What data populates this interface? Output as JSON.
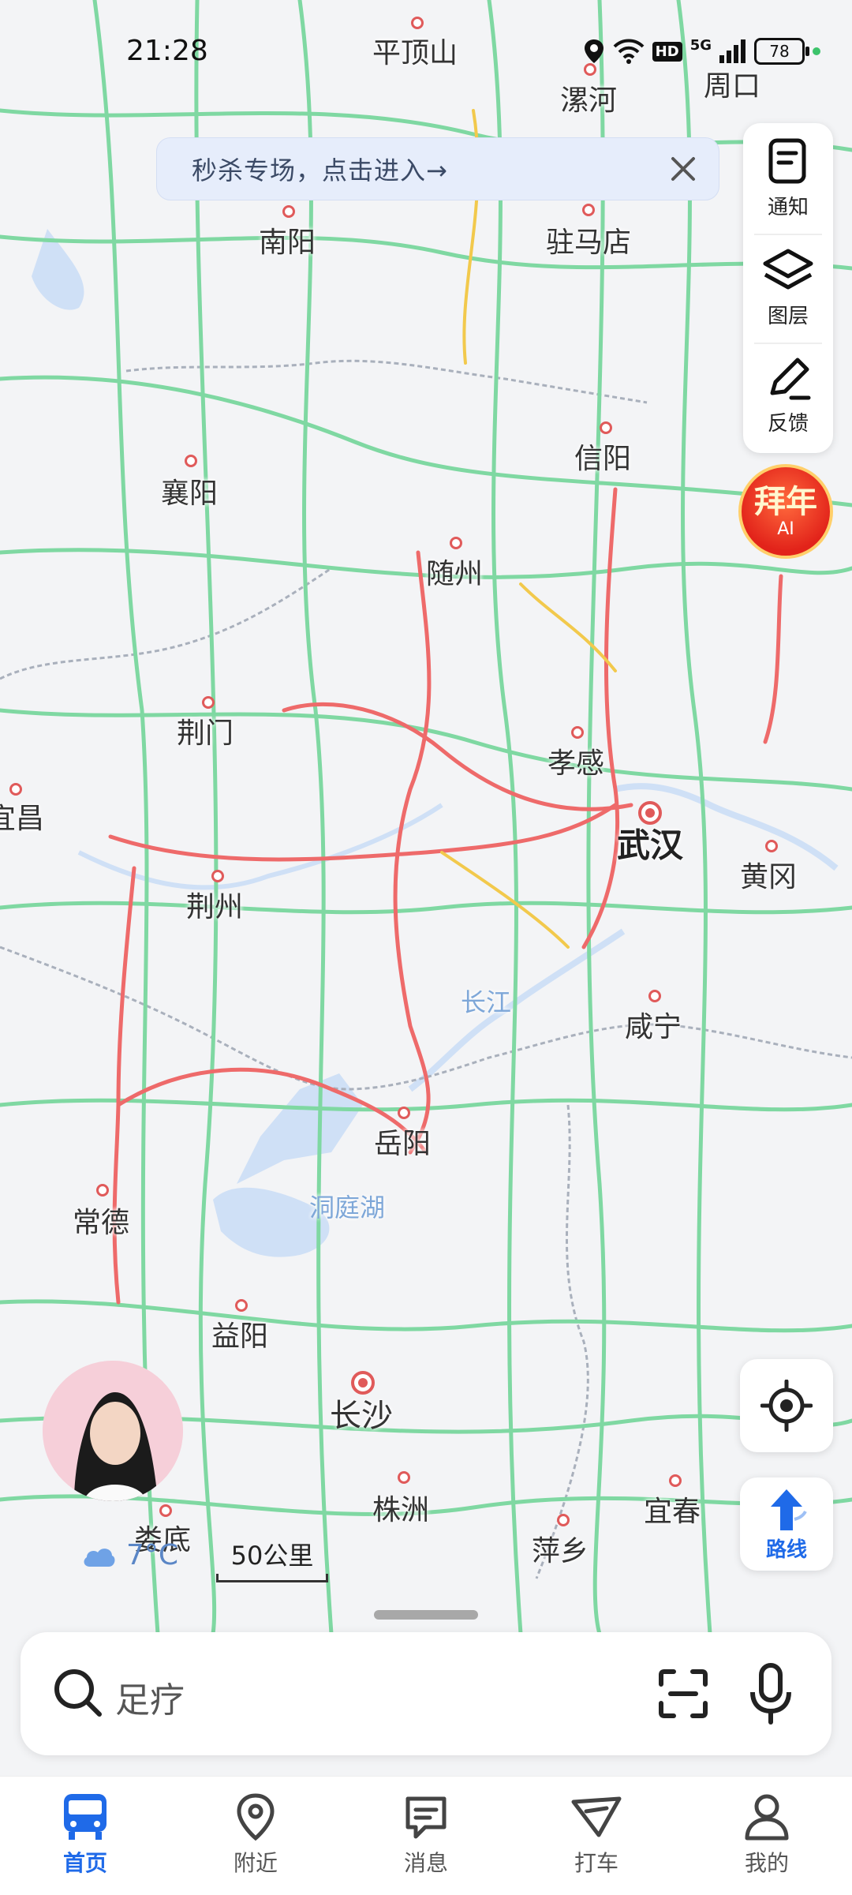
{
  "status_bar": {
    "time": "21:28",
    "network": "5G",
    "hd": "HD",
    "battery": "78"
  },
  "promo": {
    "text": "秒杀专场，点击进入→"
  },
  "tools": [
    {
      "label": "通知",
      "icon": "notification-icon"
    },
    {
      "label": "图层",
      "icon": "layers-icon"
    },
    {
      "label": "反馈",
      "icon": "feedback-icon"
    }
  ],
  "ai_badge": {
    "line1": "拜年",
    "line2": "AI"
  },
  "map": {
    "cities": [
      {
        "id": "pingdingshan",
        "name": "平顶山"
      },
      {
        "id": "luohe",
        "name": "漯河"
      },
      {
        "id": "zhoukou",
        "name": "周口"
      },
      {
        "id": "nanyang",
        "name": "南阳"
      },
      {
        "id": "zhumadian",
        "name": "驻马店"
      },
      {
        "id": "xinyang",
        "name": "信阳"
      },
      {
        "id": "xiangyang",
        "name": "襄阳"
      },
      {
        "id": "suizhou",
        "name": "随州"
      },
      {
        "id": "jingmen",
        "name": "荆门"
      },
      {
        "id": "xiaogan",
        "name": "孝感"
      },
      {
        "id": "yichang",
        "name": "宜昌"
      },
      {
        "id": "wuhan",
        "name": "武汉"
      },
      {
        "id": "huanggang",
        "name": "黄冈"
      },
      {
        "id": "jingzhou",
        "name": "荆州"
      },
      {
        "id": "changjiang",
        "name": "长江"
      },
      {
        "id": "xianning",
        "name": "咸宁"
      },
      {
        "id": "yueyang",
        "name": "岳阳"
      },
      {
        "id": "dongtinghu",
        "name": "洞庭湖"
      },
      {
        "id": "changde",
        "name": "常德"
      },
      {
        "id": "yiyang",
        "name": "益阳"
      },
      {
        "id": "changsha",
        "name": "长沙"
      },
      {
        "id": "zhuzhou",
        "name": "株洲"
      },
      {
        "id": "yichun",
        "name": "宜春"
      },
      {
        "id": "pingxiang",
        "name": "萍乡"
      },
      {
        "id": "loudi",
        "name": "娄底"
      }
    ]
  },
  "weather": {
    "temperature": "7°C",
    "icon": "cloud-icon"
  },
  "scale": {
    "label": "50公里"
  },
  "controls": {
    "route_label": "路线"
  },
  "search": {
    "placeholder": "足疗"
  },
  "nav": [
    {
      "label": "首页",
      "icon": "bus-icon",
      "active": true
    },
    {
      "label": "附近",
      "icon": "location-pin-icon",
      "active": false
    },
    {
      "label": "消息",
      "icon": "message-icon",
      "active": false
    },
    {
      "label": "打车",
      "icon": "taxi-icon",
      "active": false
    },
    {
      "label": "我的",
      "icon": "profile-icon",
      "active": false
    }
  ]
}
